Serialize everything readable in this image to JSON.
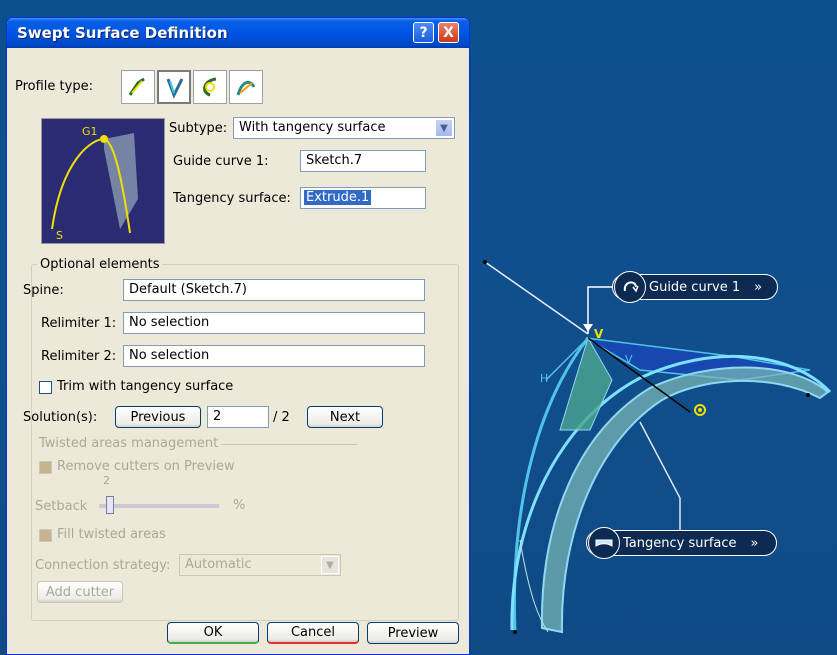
{
  "dialog": {
    "title": "Swept Surface Definition",
    "help_button": "?",
    "close_button": "X",
    "profile_type_label": "Profile type:",
    "preview_labels": {
      "g1": "G1",
      "s": "S"
    },
    "subtype_label": "Subtype:",
    "subtype_value": "With tangency surface",
    "guide_curve_label": "Guide curve 1:",
    "guide_curve_value": "Sketch.7",
    "tangency_surface_label": "Tangency surface:",
    "tangency_surface_value": "Extrude.1",
    "optional_group_title": "Optional elements",
    "spine_label": "Spine:",
    "spine_value": "Default (Sketch.7)",
    "relimiter1_label": "Relimiter 1:",
    "relimiter1_value": "No selection",
    "relimiter2_label": "Relimiter 2:",
    "relimiter2_value": "No selection",
    "trim_label": "Trim with tangency surface",
    "solutions_label": "Solution(s):",
    "previous_button": "Previous",
    "solution_value": "2",
    "solution_total": "/ 2",
    "next_button": "Next",
    "twisted_title": "Twisted areas management",
    "remove_cutters_label": "Remove cutters on Preview",
    "setback_label": "Setback",
    "setback_value": "2",
    "setback_unit": "%",
    "fill_twisted_label": "Fill twisted areas",
    "connection_label": "Connection strategy:",
    "connection_value": "Automatic",
    "add_cutter_button": "Add cutter",
    "ok_button": "OK",
    "cancel_button": "Cancel",
    "preview_button": "Preview"
  },
  "viewport": {
    "callout_guide": "Guide curve 1",
    "callout_tangency": "Tangency surface",
    "chevron": "»",
    "axis_labels": {
      "v": "V",
      "h": "H"
    }
  },
  "colors": {
    "viewport_bg": "#0f4f8e",
    "titlebar": "#0055e5",
    "dialog_bg": "#ece9d8",
    "selection": "#316ac5",
    "surface_highlight": "#4fc3e8"
  }
}
